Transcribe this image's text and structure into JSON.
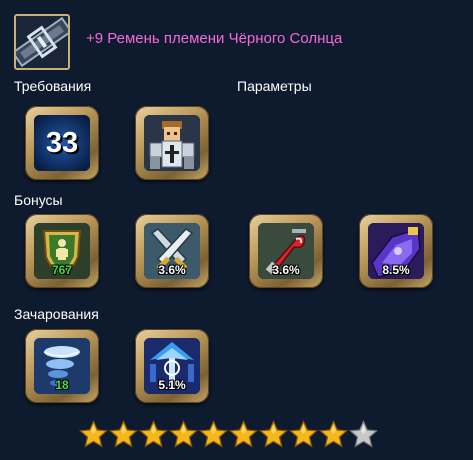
{
  "item": {
    "title": "+9 Ремень племени Чёрного Солнца",
    "icon": "belt-icon"
  },
  "sections": {
    "requirements": "Требования",
    "parameters": "Параметры",
    "bonuses": "Бонусы",
    "enchantments": "Зачарования"
  },
  "requirements": [
    {
      "icon": "level-icon",
      "value": "33"
    },
    {
      "icon": "knight-class-icon"
    }
  ],
  "bonuses": [
    {
      "icon": "shield-health-icon",
      "value": "767",
      "value_color": "green"
    },
    {
      "icon": "crossed-swords-icon",
      "value": "3.6%",
      "value_color": "white"
    },
    {
      "icon": "red-hook-weapon-icon",
      "value": "3.6%",
      "value_color": "white"
    },
    {
      "icon": "purple-gauntlet-icon",
      "value": "8.5%",
      "value_color": "white"
    }
  ],
  "enchantments": [
    {
      "icon": "blue-whirlwind-icon",
      "value": "18",
      "value_color": "green"
    },
    {
      "icon": "mana-rune-icon",
      "value": "5.1%",
      "value_color": "white"
    }
  ],
  "rating": {
    "filled": 9,
    "total": 10
  },
  "colors": {
    "title": "#f26bd6",
    "background": "#0e1a2e",
    "frame_gold": "#c9a96c",
    "value_green": "#3fe04a",
    "star_gold": "#f5b81c",
    "star_empty": "#c8c8c8"
  }
}
